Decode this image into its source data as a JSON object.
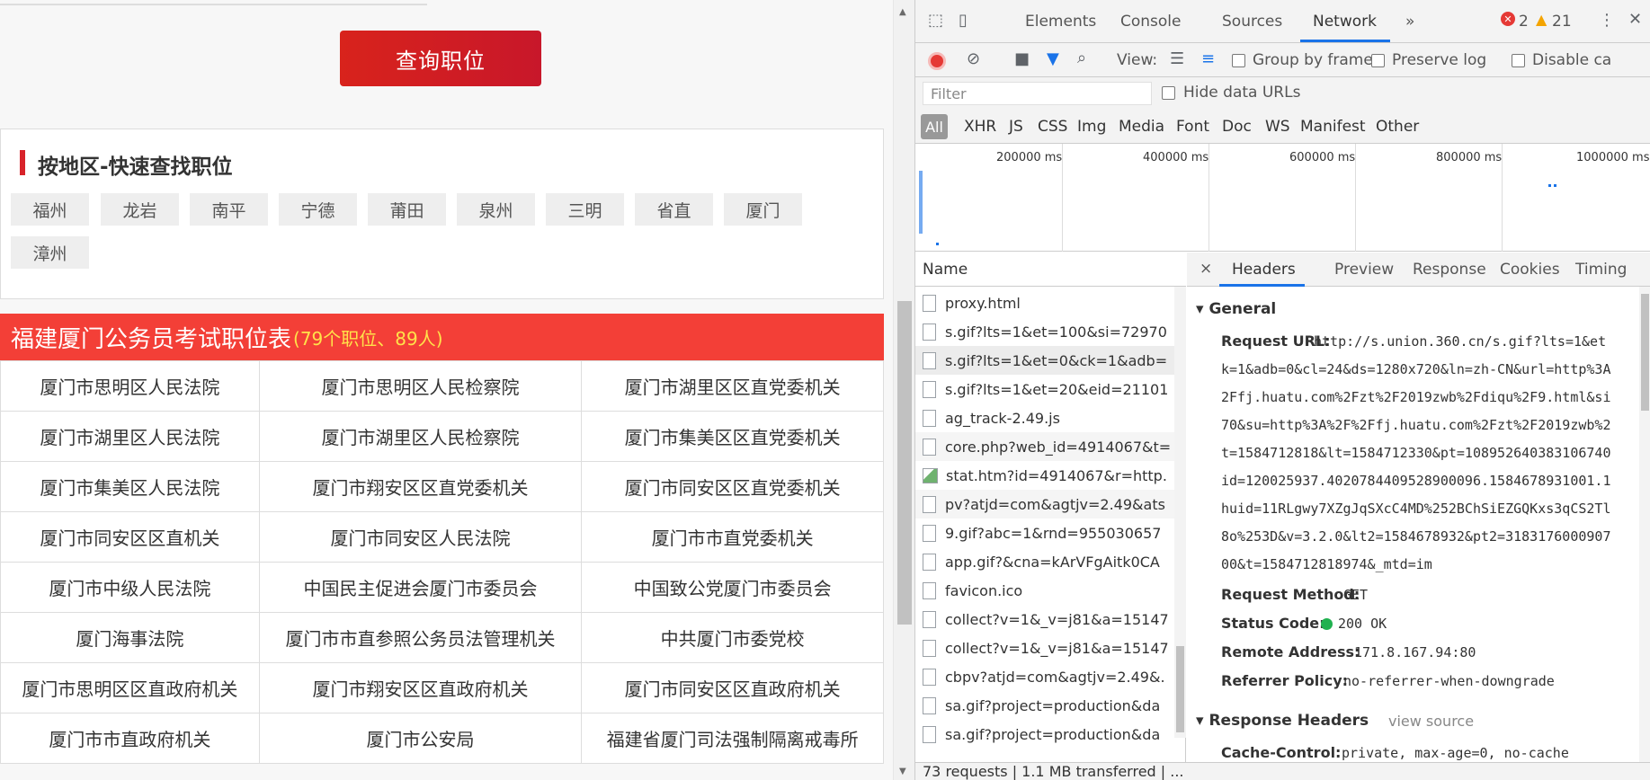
{
  "page": {
    "query_button": "查询职位",
    "region_title": "按地区-快速查找职位",
    "regions": [
      "福州",
      "龙岩",
      "南平",
      "宁德",
      "莆田",
      "泉州",
      "三明",
      "省直",
      "厦门",
      "漳州"
    ],
    "table_title": "福建厦门公务员考试职位表",
    "table_subtitle": "(79个职位、89人)",
    "table_rows": [
      [
        "厦门市思明区人民法院",
        "厦门市思明区人民检察院",
        "厦门市湖里区区直党委机关"
      ],
      [
        "厦门市湖里区人民法院",
        "厦门市湖里区人民检察院",
        "厦门市集美区区直党委机关"
      ],
      [
        "厦门市集美区人民法院",
        "厦门市翔安区区直党委机关",
        "厦门市同安区区直党委机关"
      ],
      [
        "厦门市同安区区直机关",
        "厦门市同安区人民法院",
        "厦门市市直党委机关"
      ],
      [
        "厦门市中级人民法院",
        "中国民主促进会厦门市委员会",
        "中国致公党厦门市委员会"
      ],
      [
        "厦门海事法院",
        "厦门市市直参照公务员法管理机关",
        "中共厦门市委党校"
      ],
      [
        "厦门市思明区区直政府机关",
        "厦门市翔安区区直政府机关",
        "厦门市同安区区直政府机关"
      ],
      [
        "厦门市市直政府机关",
        "厦门市公安局",
        "福建省厦门司法强制隔离戒毒所"
      ]
    ]
  },
  "devtools": {
    "tabs": [
      "Elements",
      "Console",
      "Sources",
      "Network"
    ],
    "active_tab": "Network",
    "more_tabs": "»",
    "error_count": "2",
    "warning_count": "21",
    "toolbar": {
      "view_label": "View:",
      "group_by_frame": "Group by frame",
      "preserve_log": "Preserve log",
      "disable_cache": "Disable ca"
    },
    "filter_placeholder": "Filter",
    "hide_data_urls": "Hide data URLs",
    "types": [
      "All",
      "XHR",
      "JS",
      "CSS",
      "Img",
      "Media",
      "Font",
      "Doc",
      "WS",
      "Manifest",
      "Other"
    ],
    "timeline_labels": [
      "200000 ms",
      "400000 ms",
      "600000 ms",
      "800000 ms",
      "1000000 ms"
    ],
    "name_header": "Name",
    "requests": [
      "proxy.html",
      "s.gif?lts=1&et=100&si=72970",
      "s.gif?lts=1&et=0&ck=1&adb=",
      "s.gif?lts=1&et=20&eid=21101",
      "ag_track-2.49.js",
      "core.php?web_id=4914067&t=",
      "stat.htm?id=4914067&r=http.",
      "pv?atjd=com&agtjv=2.49&ats",
      "9.gif?abc=1&rnd=955030657",
      "app.gif?&cna=kArVFgAitk0CA",
      "favicon.ico",
      "collect?v=1&_v=j81&a=15147",
      "collect?v=1&_v=j81&a=15147",
      "cbpv?atjd=com&agtjv=2.49&.",
      "sa.gif?project=production&da",
      "sa.gif?project=production&da"
    ],
    "status_bar": "73 requests | 1.1 MB transferred | ...",
    "detail_tabs": [
      "Headers",
      "Preview",
      "Response",
      "Cookies",
      "Timing"
    ],
    "close_glyph": "×",
    "general": {
      "title": "General",
      "request_url_key": "Request URL:",
      "request_url_lines": [
        "http://s.union.360.cn/s.gif?lts=1&et",
        "k=1&adb=0&cl=24&ds=1280x720&ln=zh-CN&url=http%3A",
        "2Ffj.huatu.com%2Fzt%2F2019zwb%2Fdiqu%2F9.html&si",
        "70&su=http%3A%2F%2Ffj.huatu.com%2Fzt%2F2019zwb%2",
        "t=1584712818&lt=1584712330&pt=108952640383106740",
        "id=120025937.4020784409528900096.1584678931001.1",
        "huid=11RLgwy7XZgJqSXcC4MD%252BChSiEZGQKxs3qCS2Tl",
        "8o%253D&v=3.2.0&lt2=1584678932&pt2=3183176000907",
        "00&t=1584712818974&_mtd=im"
      ],
      "request_method_key": "Request Method:",
      "request_method": "GET",
      "status_code_key": "Status Code:",
      "status_code": "200 OK",
      "remote_address_key": "Remote Address:",
      "remote_address": "171.8.167.94:80",
      "referrer_policy_key": "Referrer Policy:",
      "referrer_policy": "no-referrer-when-downgrade"
    },
    "response_headers": {
      "title": "Response Headers",
      "view_source": "view source",
      "cache_control_key": "Cache-Control:",
      "cache_control": "private, max-age=0, no-cache"
    }
  }
}
